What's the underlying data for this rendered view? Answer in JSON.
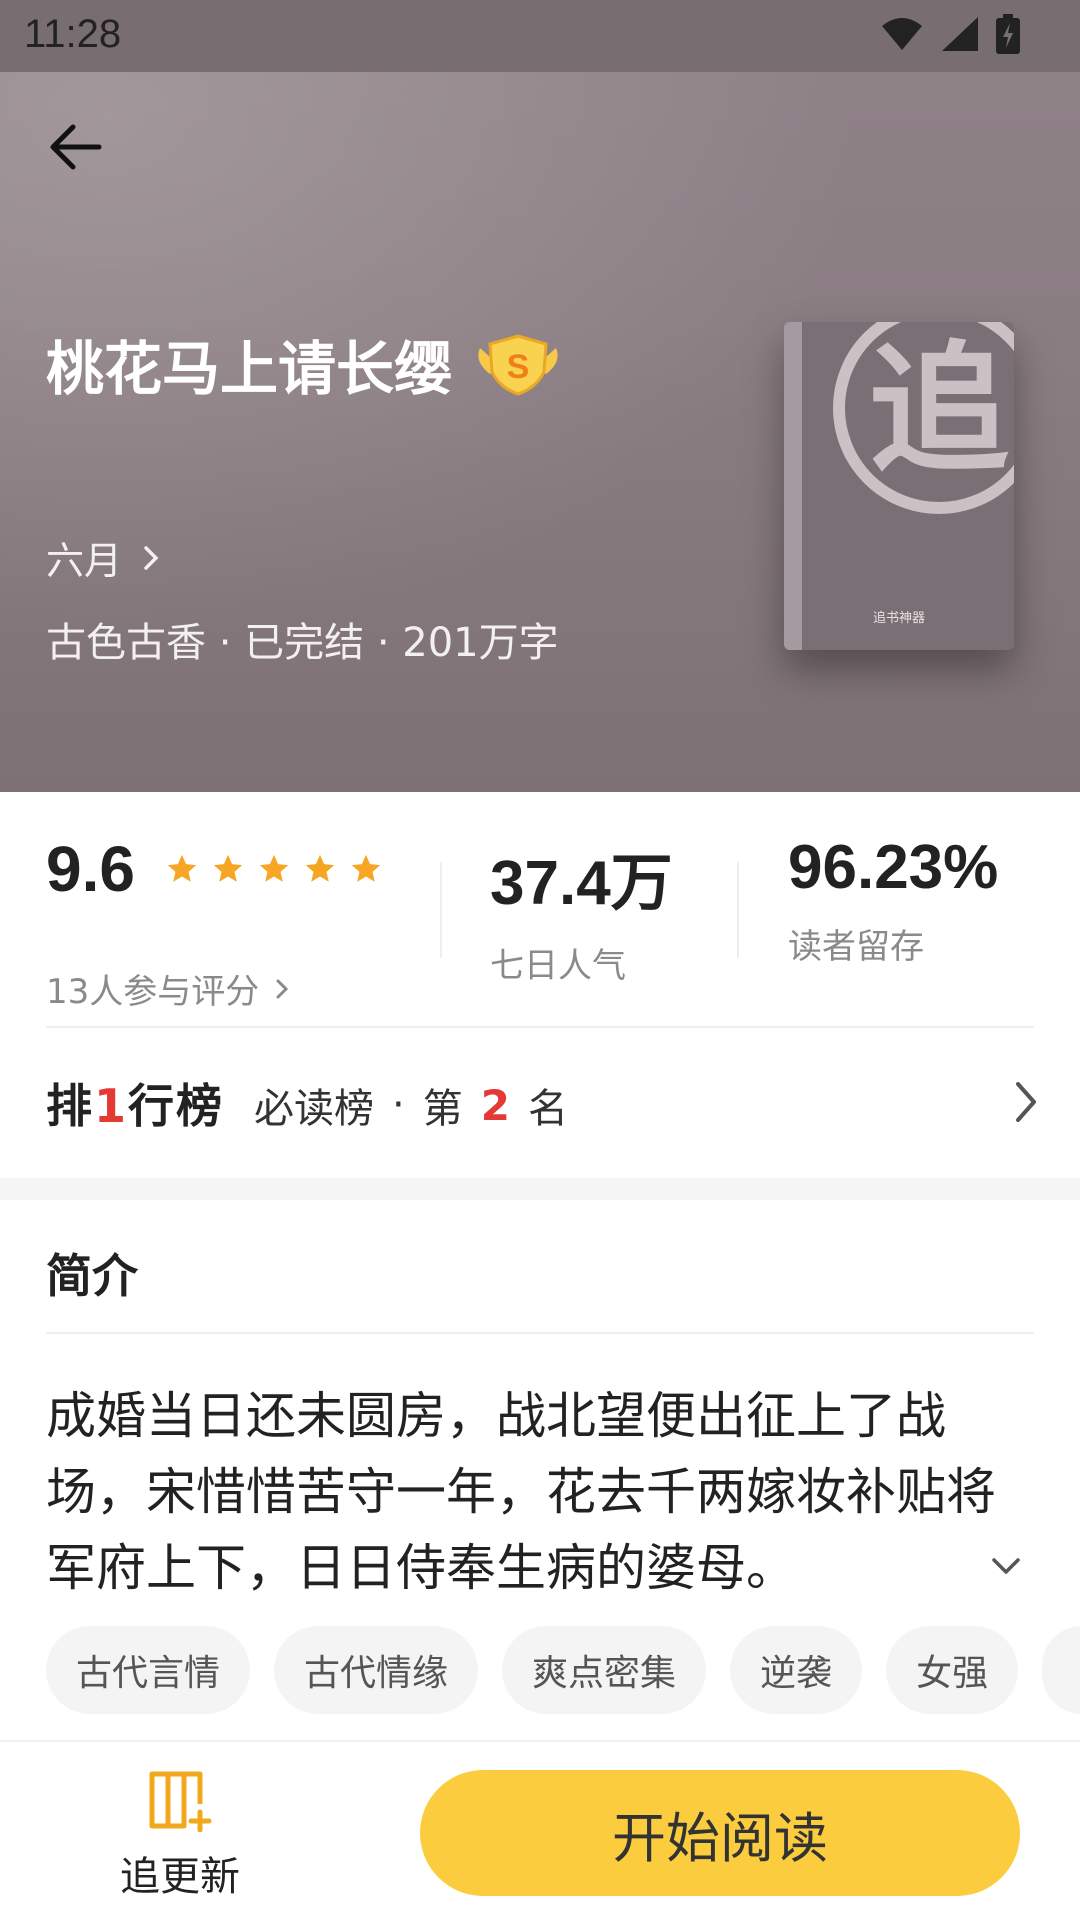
{
  "status_bar": {
    "time": "11:28"
  },
  "header": {
    "title": "桃花马上请长缨",
    "badge_letter": "S",
    "author": "六月",
    "meta": "古色古香 · 已完结 · 201万字",
    "cover_glyph": "追",
    "cover_footer": "追书神器"
  },
  "stats": {
    "rating": {
      "score": "9.6",
      "stars": 5,
      "sub": "13人参与评分"
    },
    "popularity": {
      "value": "37.4万",
      "label": "七日人气"
    },
    "retention": {
      "value": "96.23%",
      "label": "读者留存"
    }
  },
  "ranking": {
    "logo_pre": "排",
    "logo_accent": "1",
    "logo_post": "行榜",
    "list_name": "必读榜",
    "dot": "·",
    "prefix": "第",
    "position": "2",
    "suffix": "名"
  },
  "intro": {
    "title": "简介",
    "text": "成婚当日还未圆房，战北望便出征上了战场，宋惜惜苦守一年，花去千两嫁妆补贴将军府上下，日日侍奉生病的婆母。"
  },
  "tags": [
    "古代言情",
    "古代情缘",
    "爽点密集",
    "逆袭",
    "女强"
  ],
  "bottom_bar": {
    "follow_label": "追更新",
    "read_label": "开始阅读"
  },
  "colors": {
    "accent_yellow": "#fbcd3e",
    "rank_red": "#e53935",
    "star_orange": "#f6a623",
    "hero_bg": "#8b7e83"
  },
  "icons": [
    "wifi-icon",
    "signal-icon",
    "battery-icon",
    "back-arrow-icon",
    "s-badge-icon",
    "chevron-right-icon",
    "star-icon",
    "chevron-down-icon",
    "book-add-icon"
  ]
}
